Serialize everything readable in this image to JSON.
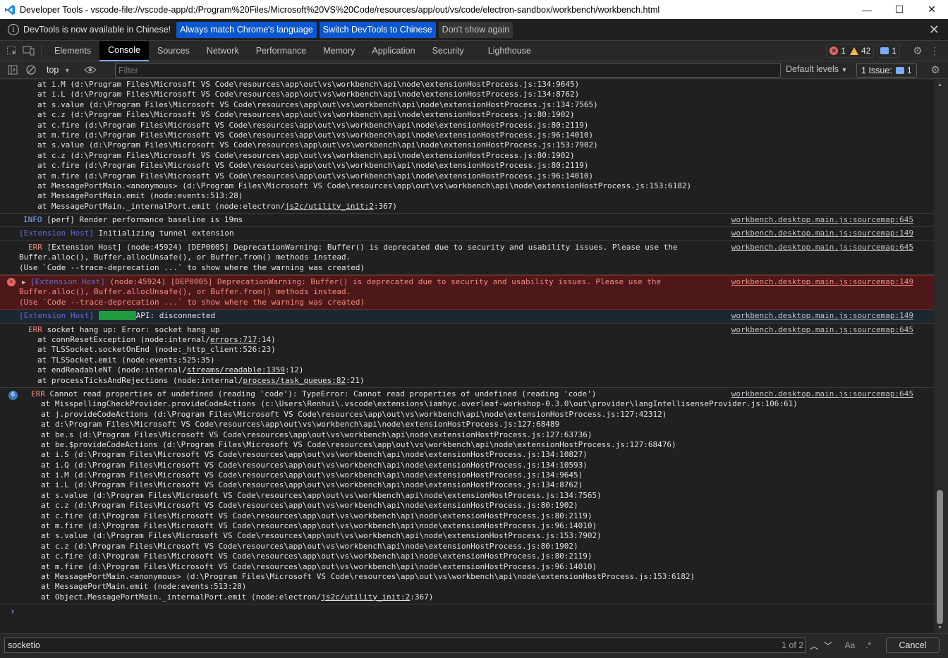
{
  "window": {
    "title": "Developer Tools - vscode-file://vscode-app/d:/Program%20Files/Microsoft%20VS%20Code/resources/app/out/vs/code/electron-sandbox/workbench/workbench.html"
  },
  "infobar": {
    "message": "DevTools is now available in Chinese!",
    "btn_match": "Always match Chrome's language",
    "btn_switch": "Switch DevTools to Chinese",
    "btn_dismiss": "Don't show again"
  },
  "tabs": [
    "Elements",
    "Console",
    "Sources",
    "Network",
    "Performance",
    "Memory",
    "Application",
    "Security",
    "Lighthouse"
  ],
  "counts": {
    "errors": "1",
    "warnings": "42",
    "messages": "1"
  },
  "toolbar": {
    "context": "top",
    "filter_placeholder": "Filter",
    "levels": "Default levels",
    "issues_label": "1 Issue:",
    "issues_count": "1"
  },
  "source": {
    "s645": "workbench.desktop.main.js:sourcemap:645",
    "s149": "workbench.desktop.main.js:sourcemap:149"
  },
  "console": {
    "top_stack": [
      "at i.M (d:\\Program Files\\Microsoft VS Code\\resources\\app\\out\\vs\\workbench\\api\\node\\extensionHostProcess.js:134:9645)",
      "at i.L (d:\\Program Files\\Microsoft VS Code\\resources\\app\\out\\vs\\workbench\\api\\node\\extensionHostProcess.js:134:8762)",
      "at s.value (d:\\Program Files\\Microsoft VS Code\\resources\\app\\out\\vs\\workbench\\api\\node\\extensionHostProcess.js:134:7565)",
      "at c.z (d:\\Program Files\\Microsoft VS Code\\resources\\app\\out\\vs\\workbench\\api\\node\\extensionHostProcess.js:80:1902)",
      "at c.fire (d:\\Program Files\\Microsoft VS Code\\resources\\app\\out\\vs\\workbench\\api\\node\\extensionHostProcess.js:80:2119)",
      "at m.fire (d:\\Program Files\\Microsoft VS Code\\resources\\app\\out\\vs\\workbench\\api\\node\\extensionHostProcess.js:96:14010)",
      "at s.value (d:\\Program Files\\Microsoft VS Code\\resources\\app\\out\\vs\\workbench\\api\\node\\extensionHostProcess.js:153:7902)",
      "at c.z (d:\\Program Files\\Microsoft VS Code\\resources\\app\\out\\vs\\workbench\\api\\node\\extensionHostProcess.js:80:1902)",
      "at c.fire (d:\\Program Files\\Microsoft VS Code\\resources\\app\\out\\vs\\workbench\\api\\node\\extensionHostProcess.js:80:2119)",
      "at m.fire (d:\\Program Files\\Microsoft VS Code\\resources\\app\\out\\vs\\workbench\\api\\node\\extensionHostProcess.js:96:14010)",
      "at MessagePortMain.<anonymous> (d:\\Program Files\\Microsoft VS Code\\resources\\app\\out\\vs\\workbench\\api\\node\\extensionHostProcess.js:153:6182)",
      "at MessagePortMain.emit (node:events:513:28)"
    ],
    "top_last_prefix": "at MessagePortMain._internalPort.emit (node:electron/",
    "top_last_link": "js2c/utility_init:2",
    "top_last_suffix": ":367)",
    "info_tag": "INFO",
    "info_text": " [perf] Render performance baseline is 19ms",
    "ext_tag": "[Extension Host]",
    "tunnel_text": " Initializing tunnel extension",
    "err_tag": "ERR",
    "dep1_l1": " [Extension Host] (node:45924) [DEP0005] DeprecationWarning: Buffer() is deprecated due to security and usability issues. Please use the",
    "dep_l2": "Buffer.alloc(), Buffer.allocUnsafe(), or Buffer.from() methods instead.",
    "dep_l3": "(Use `Code --trace-deprecation ...` to show where the warning was created)",
    "dep2_l1": " (node:45924) [DEP0005] DeprecationWarning: Buffer() is deprecated due to security and usability issues. Please use the",
    "socket_match": "SocketIO",
    "socket_text": "API: disconnected",
    "hang_text": " socket hang up: Error: socket hang up",
    "hang_stack": [
      {
        "pre": "at connResetException (node:internal/",
        "link": "errors:717",
        "post": ":14)"
      },
      {
        "pre": "at TLSSocket.socketOnEnd (node:_http_client:526:23)",
        "link": "",
        "post": ""
      },
      {
        "pre": "at TLSSocket.emit (node:events:525:35)",
        "link": "",
        "post": ""
      },
      {
        "pre": "at endReadableNT (node:internal/",
        "link": "streams/readable:1359",
        "post": ":12)"
      },
      {
        "pre": "at processTicksAndRejections (node:internal/",
        "link": "process/task_queues:82",
        "post": ":21)"
      }
    ],
    "repeat_count": "6",
    "code_err_text": " Cannot read properties of undefined (reading 'code'): TypeError: Cannot read properties of undefined (reading 'code')",
    "code_stack": [
      "at MisspellingCheckProvider.provideCodeActions (c:\\Users\\Renhui\\.vscode\\extensions\\iamhyc.overleaf-workshop-0.3.0\\out\\provider\\langIntellisenseProvider.js:106:61)",
      "at j.provideCodeActions (d:\\Program Files\\Microsoft VS Code\\resources\\app\\out\\vs\\workbench\\api\\node\\extensionHostProcess.js:127:42312)",
      "at d:\\Program Files\\Microsoft VS Code\\resources\\app\\out\\vs\\workbench\\api\\node\\extensionHostProcess.js:127:68489",
      "at be.s (d:\\Program Files\\Microsoft VS Code\\resources\\app\\out\\vs\\workbench\\api\\node\\extensionHostProcess.js:127:63736)",
      "at be.$provideCodeActions (d:\\Program Files\\Microsoft VS Code\\resources\\app\\out\\vs\\workbench\\api\\node\\extensionHostProcess.js:127:68476)",
      "at i.S (d:\\Program Files\\Microsoft VS Code\\resources\\app\\out\\vs\\workbench\\api\\node\\extensionHostProcess.js:134:10827)",
      "at i.Q (d:\\Program Files\\Microsoft VS Code\\resources\\app\\out\\vs\\workbench\\api\\node\\extensionHostProcess.js:134:10593)",
      "at i.M (d:\\Program Files\\Microsoft VS Code\\resources\\app\\out\\vs\\workbench\\api\\node\\extensionHostProcess.js:134:9645)",
      "at i.L (d:\\Program Files\\Microsoft VS Code\\resources\\app\\out\\vs\\workbench\\api\\node\\extensionHostProcess.js:134:8762)",
      "at s.value (d:\\Program Files\\Microsoft VS Code\\resources\\app\\out\\vs\\workbench\\api\\node\\extensionHostProcess.js:134:7565)",
      "at c.z (d:\\Program Files\\Microsoft VS Code\\resources\\app\\out\\vs\\workbench\\api\\node\\extensionHostProcess.js:80:1902)",
      "at c.fire (d:\\Program Files\\Microsoft VS Code\\resources\\app\\out\\vs\\workbench\\api\\node\\extensionHostProcess.js:80:2119)",
      "at m.fire (d:\\Program Files\\Microsoft VS Code\\resources\\app\\out\\vs\\workbench\\api\\node\\extensionHostProcess.js:96:14010)",
      "at s.value (d:\\Program Files\\Microsoft VS Code\\resources\\app\\out\\vs\\workbench\\api\\node\\extensionHostProcess.js:153:7902)",
      "at c.z (d:\\Program Files\\Microsoft VS Code\\resources\\app\\out\\vs\\workbench\\api\\node\\extensionHostProcess.js:80:1902)",
      "at c.fire (d:\\Program Files\\Microsoft VS Code\\resources\\app\\out\\vs\\workbench\\api\\node\\extensionHostProcess.js:80:2119)",
      "at m.fire (d:\\Program Files\\Microsoft VS Code\\resources\\app\\out\\vs\\workbench\\api\\node\\extensionHostProcess.js:96:14010)",
      "at MessagePortMain.<anonymous> (d:\\Program Files\\Microsoft VS Code\\resources\\app\\out\\vs\\workbench\\api\\node\\extensionHostProcess.js:153:6182)",
      "at MessagePortMain.emit (node:events:513:28)"
    ],
    "code_last_prefix": "at Object.MessagePortMain._internalPort.emit (node:electron/",
    "code_last_link": "js2c/utility_init:2",
    "code_last_suffix": ":367)",
    "prompt": "›"
  },
  "search": {
    "query": "socketio",
    "match_count": "1 of 2",
    "case_label": "Aa",
    "regex_label": ".*",
    "cancel": "Cancel"
  }
}
